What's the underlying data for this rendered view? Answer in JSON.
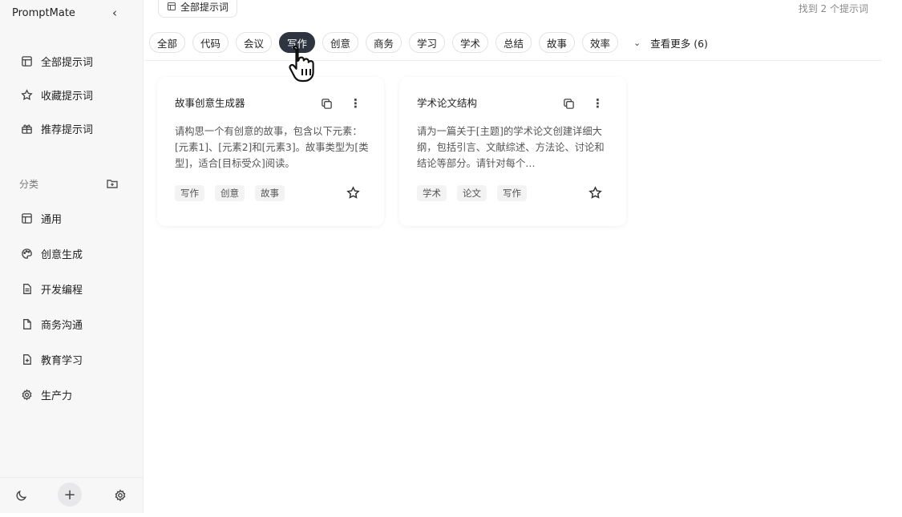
{
  "app": {
    "title": "PromptMate",
    "collapse_glyph": "‹"
  },
  "sidebar": {
    "nav": [
      {
        "label": "全部提示词",
        "icon": "layout-icon"
      },
      {
        "label": "收藏提示词",
        "icon": "star-icon"
      },
      {
        "label": "推荐提示词",
        "icon": "gift-icon"
      }
    ],
    "categories_header": "分类",
    "categories": [
      {
        "label": "通用",
        "icon": "layout-icon"
      },
      {
        "label": "创意生成",
        "icon": "palette-icon"
      },
      {
        "label": "开发编程",
        "icon": "file-code-icon"
      },
      {
        "label": "商务沟通",
        "icon": "file-icon"
      },
      {
        "label": "教育学习",
        "icon": "file-plus-icon"
      },
      {
        "label": "生产力",
        "icon": "gear-icon"
      }
    ],
    "bottom": {
      "plus": "+"
    }
  },
  "header": {
    "breadcrumb": "全部提示词",
    "found": "找到 2 个提示词"
  },
  "filters": {
    "tags": [
      "全部",
      "代码",
      "会议",
      "写作",
      "创意",
      "商务",
      "学习",
      "学术",
      "总结",
      "故事",
      "效率"
    ],
    "active": "写作",
    "more_label": "查看更多 (6)"
  },
  "cards": [
    {
      "title": "故事创意生成器",
      "description": "请构思一个有创意的故事，包含以下元素：[元素1]、[元素2]和[元素3]。故事类型为[类型]，适合[目标受众]阅读。",
      "tags": [
        "写作",
        "创意",
        "故事"
      ]
    },
    {
      "title": "学术论文结构",
      "description": "请为一篇关于[主题]的学术论文创建详细大纲，包括引言、文献综述、方法论、讨论和结论等部分。请针对每个…",
      "tags": [
        "学术",
        "论文",
        "写作"
      ]
    }
  ],
  "colors": {
    "active_chip": "#2f3441",
    "sidebar_bg": "#f7f7f8"
  }
}
